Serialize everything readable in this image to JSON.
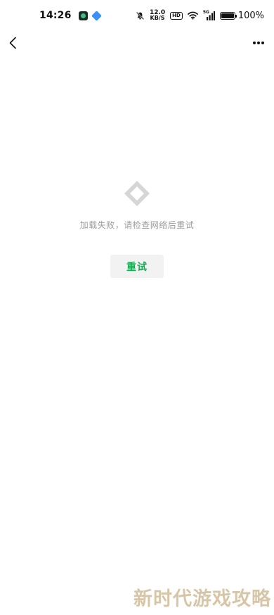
{
  "status_bar": {
    "time": "14:26",
    "net_speed_value": "12.0",
    "net_speed_unit": "KB/S",
    "hd_label": "HD",
    "signal_label": "5G",
    "battery_percent": "100%",
    "battery_level": 1.0,
    "icons": [
      "app-icon-1",
      "app-icon-2",
      "mute-bell-icon",
      "hd-icon",
      "wifi-icon",
      "signal-icon",
      "battery-icon"
    ]
  },
  "nav": {
    "back_icon": "chevron-left-icon",
    "more_icon": "more-dots-icon"
  },
  "error": {
    "icon": "app-logo-icon",
    "message": "加载失败，请检查网络后重试",
    "retry_label": "重试"
  },
  "watermark": {
    "text": "新时代游戏攻略"
  },
  "colors": {
    "accent": "#1aaa55",
    "muted_text": "#9b9b9b",
    "button_bg": "#f2f2f2",
    "icon_grey": "#d6d6d6"
  }
}
